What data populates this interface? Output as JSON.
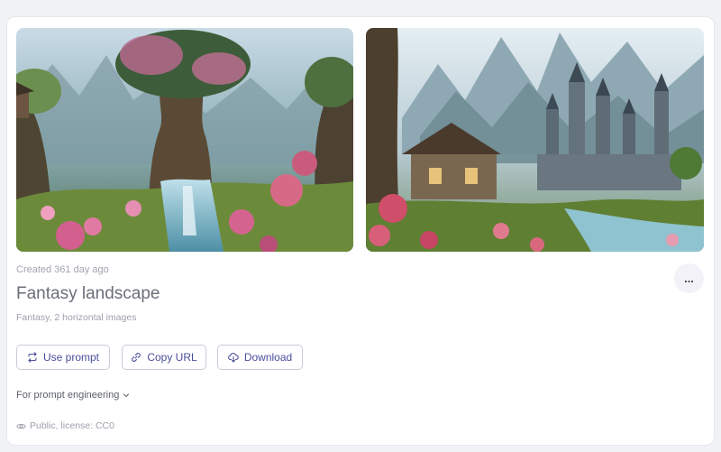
{
  "card": {
    "images": [
      {
        "alt": "fantasy-forest-waterfall",
        "icon": "image"
      },
      {
        "alt": "fantasy-castle-valley",
        "icon": "image"
      }
    ],
    "created": "Created 361 day ago",
    "more_label": "...",
    "title": "Fantasy landscape",
    "subtitle": "Fantasy, 2 horizontal images",
    "buttons": {
      "use_prompt": "Use prompt",
      "copy_url": "Copy URL",
      "download": "Download"
    },
    "dropdown_label": "For prompt engineering",
    "license": "Public, license: CC0"
  },
  "colors": {
    "accent": "#4a4f9c",
    "border": "#c9ccd8",
    "muted_text": "#9da0ab",
    "background": "#f1f2f5"
  }
}
